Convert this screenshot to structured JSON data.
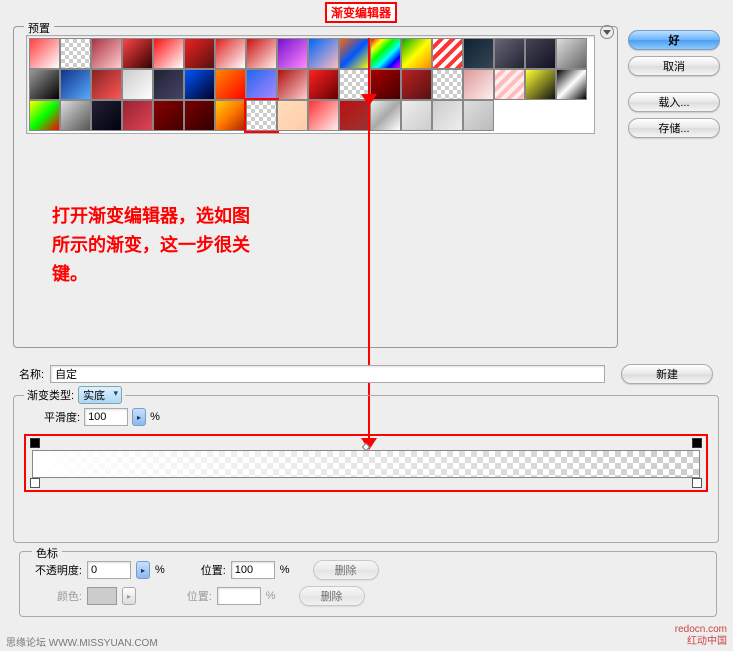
{
  "title": "渐变编辑器",
  "presets_label": "预置",
  "annotation": "打开渐变编辑器，选如图\n所示的渐变，这一步很关\n键。",
  "buttons": {
    "ok": "好",
    "cancel": "取消",
    "load": "载入...",
    "save": "存储...",
    "new": "新建",
    "delete": "删除"
  },
  "name_label": "名称:",
  "name_value": "自定",
  "type_label": "渐变类型:",
  "type_value": "实底",
  "smooth_label": "平滑度:",
  "smooth_value": "100",
  "stops_label": "色标",
  "opacity_label": "不透明度:",
  "opacity_value": "0",
  "location_label": "位置:",
  "location_value": "100",
  "color_label": "颜色:",
  "percent": "%",
  "footer_left": "思缘论坛  WWW.MISSYUAN.COM",
  "footer_right_1": "redocn.com",
  "footer_right_2": "红动中国",
  "swatches": [
    {
      "bg": "linear-gradient(135deg,#ff4141,#fff)"
    },
    {
      "bg": "repeating-conic-gradient(#ccc 0 25%,#fff 0 50%) 0 0/8px 8px"
    },
    {
      "bg": "linear-gradient(135deg,#a34,#fcc)"
    },
    {
      "bg": "linear-gradient(135deg,#f44,#300)"
    },
    {
      "bg": "linear-gradient(135deg,#f11,#fff)"
    },
    {
      "bg": "linear-gradient(135deg,#e22,#511)"
    },
    {
      "bg": "linear-gradient(135deg,#d22,#fff)"
    },
    {
      "bg": "linear-gradient(135deg,#c11,#fee)"
    },
    {
      "bg": "linear-gradient(135deg,#71c,#f8f)"
    },
    {
      "bg": "linear-gradient(135deg,#06f,#fbb)"
    },
    {
      "bg": "linear-gradient(135deg,#f60,#05f,#ff0)"
    },
    {
      "bg": "linear-gradient(135deg,#f00,#ff0,#0f0,#0ff,#00f,#f0f)"
    },
    {
      "bg": "linear-gradient(135deg,#0a0,#ff0,#f80)"
    },
    {
      "bg": "repeating-linear-gradient(135deg,#fff 0 4px,#f33 4px 8px)"
    },
    {
      "bg": "linear-gradient(135deg,#123,#345)"
    },
    {
      "bg": "linear-gradient(135deg,#667,#223)"
    },
    {
      "bg": "linear-gradient(135deg,#445,#112)"
    },
    {
      "bg": "linear-gradient(135deg,#ddd,#666)"
    },
    {
      "bg": "linear-gradient(135deg,#999,#000)"
    },
    {
      "bg": "linear-gradient(135deg,#138,#5af)"
    },
    {
      "bg": "linear-gradient(135deg,#822,#f55)"
    },
    {
      "bg": "linear-gradient(135deg,#ccc,#fff)"
    },
    {
      "bg": "linear-gradient(135deg,#223,#446)"
    },
    {
      "bg": "linear-gradient(135deg,#05f,#002)"
    },
    {
      "bg": "linear-gradient(135deg,#f80,#f00)"
    },
    {
      "bg": "linear-gradient(135deg,#26e,#a8f)"
    },
    {
      "bg": "linear-gradient(135deg,#a11,#fcc)"
    },
    {
      "bg": "linear-gradient(135deg,#f22,#600)"
    },
    {
      "bg": "repeating-conic-gradient(#ccc 0 25%,#fff 0 50%) 0 0/8px 8px"
    },
    {
      "bg": "linear-gradient(135deg,#a00,#400)"
    },
    {
      "bg": "linear-gradient(135deg,#b22,#511)"
    },
    {
      "bg": "repeating-conic-gradient(#ccc 0 25%,#fff 0 50%) 0 0/8px 8px"
    },
    {
      "bg": "linear-gradient(135deg,#d99,#fee)"
    },
    {
      "bg": "repeating-linear-gradient(135deg,#fee 0 4px,#fbb 4px 8px)"
    },
    {
      "bg": "linear-gradient(135deg,#ff3,#111)"
    },
    {
      "bg": "linear-gradient(135deg,#000,#fff,#000)"
    },
    {
      "bg": "linear-gradient(135deg,#ff0,#0f0,#f00)"
    },
    {
      "bg": "linear-gradient(135deg,#ddd,#555)"
    },
    {
      "bg": "linear-gradient(135deg,#223,#001)"
    },
    {
      "bg": "linear-gradient(135deg,#923,#d45)"
    },
    {
      "bg": "linear-gradient(135deg,#800,#400)"
    },
    {
      "bg": "linear-gradient(135deg,#700,#300)"
    },
    {
      "bg": "linear-gradient(135deg,#fc0,#f70,#a20)"
    },
    {
      "bg": "repeating-conic-gradient(#ccc 0 25%,#fff 0 50%) 0 0/8px 8px",
      "selected": true
    },
    {
      "bg": "linear-gradient(135deg,#fdb,#fca)"
    },
    {
      "bg": "linear-gradient(135deg,#f33,#fee)"
    },
    {
      "bg": "linear-gradient(135deg,#b11,#933)"
    },
    {
      "bg": "linear-gradient(135deg,#eee,#aaa,#fff)"
    },
    {
      "bg": "linear-gradient(135deg,#eee,#ccc)"
    },
    {
      "bg": "linear-gradient(135deg,#ccc,#eee)"
    },
    {
      "bg": "linear-gradient(135deg,#ddd,#bbb)"
    }
  ]
}
